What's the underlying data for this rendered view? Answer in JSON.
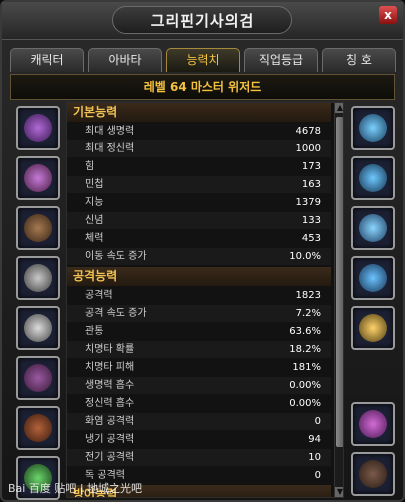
{
  "window": {
    "title": "그리핀기사의검",
    "close_label": "x"
  },
  "tabs": [
    {
      "label": "캐릭터",
      "active": false
    },
    {
      "label": "아바타",
      "active": false
    },
    {
      "label": "능력치",
      "active": true
    },
    {
      "label": "직업등급",
      "active": false
    },
    {
      "label": "칭 호",
      "active": false
    }
  ],
  "level_banner": "레벨 64 마스터 위저드",
  "stats": {
    "basic": {
      "title": "기본능력",
      "rows": [
        {
          "label": "최대 생명력",
          "value": "4678"
        },
        {
          "label": "최대 정신력",
          "value": "1000"
        },
        {
          "label": "힘",
          "value": "173"
        },
        {
          "label": "민첩",
          "value": "163"
        },
        {
          "label": "지능",
          "value": "1379"
        },
        {
          "label": "신념",
          "value": "133"
        },
        {
          "label": "체력",
          "value": "453"
        },
        {
          "label": "이동 속도 증가",
          "value": "10.0%"
        }
      ]
    },
    "attack": {
      "title": "공격능력",
      "rows": [
        {
          "label": "공격력",
          "value": "1823"
        },
        {
          "label": "공격 속도 증가",
          "value": "7.2%"
        },
        {
          "label": "관통",
          "value": "63.6%"
        },
        {
          "label": "치명타 확률",
          "value": "18.2%"
        },
        {
          "label": "치명타 피해",
          "value": "181%"
        },
        {
          "label": "생명력 흡수",
          "value": "0.00%"
        },
        {
          "label": "정신력 흡수",
          "value": "0.00%"
        },
        {
          "label": "화염 공격력",
          "value": "0"
        },
        {
          "label": "냉기 공격력",
          "value": "94"
        },
        {
          "label": "전기 공격력",
          "value": "10"
        },
        {
          "label": "독 공격력",
          "value": "0"
        }
      ]
    },
    "defense": {
      "title": "방어능력"
    }
  },
  "watermark": "Bai 百度 贴吧 | 地城之光吧",
  "colors": {
    "accent": "#f3c443",
    "section": "#f1c253",
    "window_bg": "#1a1a1a"
  },
  "equipment_left": [
    "hat-icon",
    "shoulder-icon",
    "chest-icon",
    "belt-icon",
    "bracelet-icon",
    "glove-icon",
    "boot-icon",
    "book-icon"
  ],
  "equipment_right": [
    "earring-icon",
    "earring-icon",
    "ring-icon",
    "ring-icon",
    "amulet-icon",
    "wand-icon",
    "offhand-slot-icon"
  ]
}
